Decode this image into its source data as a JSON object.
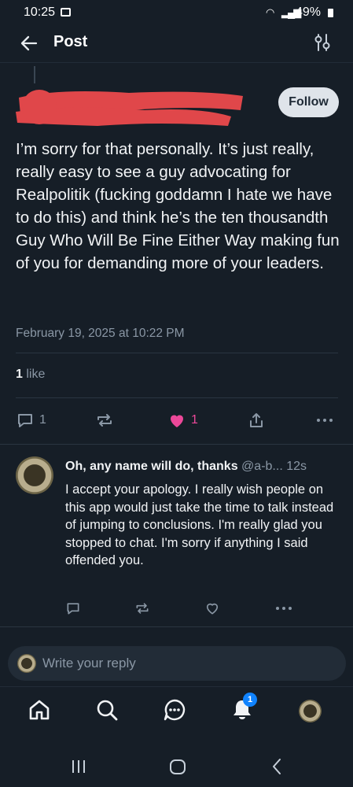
{
  "status_bar": {
    "time": "10:25",
    "battery": "49%"
  },
  "header": {
    "title": "Post"
  },
  "post": {
    "follow_label": "Follow",
    "text": "I’m sorry for that personally. It’s just really, really easy to see a guy advocating for Realpolitik (fucking goddamn I hate we have to do this) and think he’s the ten thousandth Guy Who Will Be Fine Either Way making fun of you for demanding more of your leaders.",
    "date": "February 19, 2025 at 10:22 PM",
    "like_count_bold": "1",
    "like_word": " like",
    "reply_count": "1",
    "liked_count": "1"
  },
  "reply": {
    "name": "Oh, any name will do, thanks",
    "handle": " @a-b...",
    "time": " 12s",
    "text": "I accept your apology. I really wish people on this app would just take the time to talk instead of jumping to conclusions. I'm really glad you stopped to chat. I'm sorry if anything I said offended you."
  },
  "compose": {
    "placeholder": "Write your reply"
  },
  "tabbar": {
    "notification_badge": "1"
  },
  "colors": {
    "background": "#161e27",
    "like_pink": "#ec4899",
    "badge_blue": "#1083fe",
    "muted_text": "#8a97a5"
  },
  "icons": [
    "back-arrow-icon",
    "settings-sliders-icon",
    "reply-icon",
    "repost-icon",
    "heart-icon",
    "share-icon",
    "more-icon",
    "home-icon",
    "search-icon",
    "chat-icon",
    "bell-icon"
  ]
}
